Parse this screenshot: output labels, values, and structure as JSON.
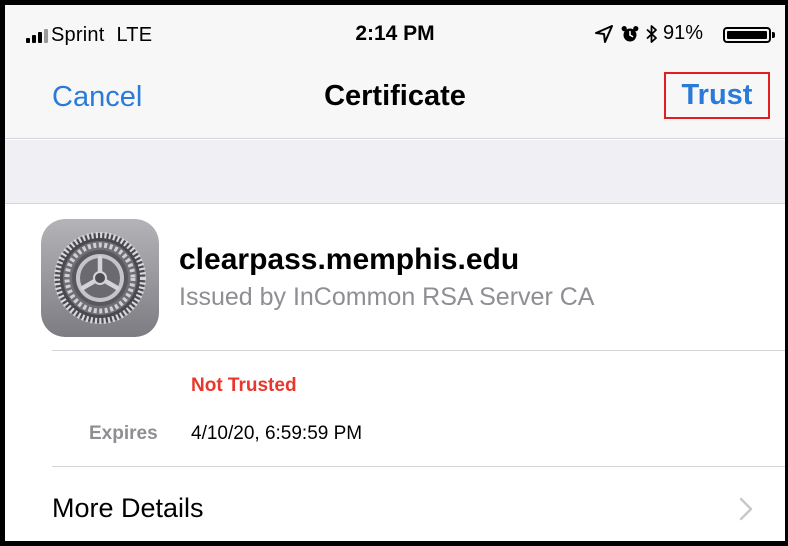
{
  "status_bar": {
    "carrier": "Sprint",
    "network": "LTE",
    "time": "2:14 PM",
    "battery_percent": "91%",
    "battery_level": 0.91,
    "icons": [
      "signal-icon",
      "location-icon",
      "alarm-icon",
      "bluetooth-icon",
      "battery-icon"
    ]
  },
  "nav": {
    "cancel_label": "Cancel",
    "title": "Certificate",
    "trust_label": "Trust"
  },
  "certificate": {
    "icon": "settings-gear-icon",
    "name": "clearpass.memphis.edu",
    "issuer": "Issued by InCommon RSA Server CA",
    "trust_status": "Not Trusted",
    "expires_label": "Expires",
    "expires_value": "4/10/20, 6:59:59 PM"
  },
  "more_details": {
    "label": "More Details",
    "icon": "chevron-right-icon"
  },
  "colors": {
    "accent": "#2a7bd9",
    "danger": "#e8372c",
    "highlight_box": "#e02020",
    "secondary_text": "#8e8e93",
    "bar_bg": "#f7f7f7",
    "group_bg": "#efeff4"
  }
}
